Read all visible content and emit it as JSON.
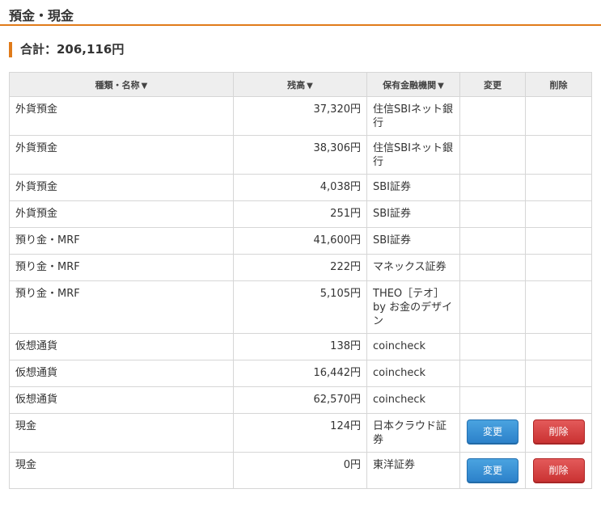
{
  "section_title": "預金・現金",
  "total_label": "合計：206,116円",
  "columns": {
    "name": "種類・名称",
    "balance": "残高",
    "institution": "保有金融機関",
    "edit": "変更",
    "delete": "削除"
  },
  "sort_icon": "triangle-down",
  "rows": [
    {
      "name": "外貨預金",
      "balance": "37,320円",
      "institution": "住信SBIネット銀行"
    },
    {
      "name": "外貨預金",
      "balance": "38,306円",
      "institution": "住信SBIネット銀行"
    },
    {
      "name": "外貨預金",
      "balance": "4,038円",
      "institution": "SBI証券"
    },
    {
      "name": "外貨預金",
      "balance": "251円",
      "institution": "SBI証券"
    },
    {
      "name": "預り金・MRF",
      "balance": "41,600円",
      "institution": "SBI証券"
    },
    {
      "name": "預り金・MRF",
      "balance": "222円",
      "institution": "マネックス証券"
    },
    {
      "name": "預り金・MRF",
      "balance": "5,105円",
      "institution": "THEO［テオ］ by お金のデザイン"
    },
    {
      "name": "仮想通貨",
      "balance": "138円",
      "institution": "coincheck"
    },
    {
      "name": "仮想通貨",
      "balance": "16,442円",
      "institution": "coincheck"
    },
    {
      "name": "仮想通貨",
      "balance": "62,570円",
      "institution": "coincheck"
    },
    {
      "name": "現金",
      "balance": "124円",
      "institution": "日本クラウド証券",
      "edit_label": "変更",
      "delete_label": "削除"
    },
    {
      "name": "現金",
      "balance": "0円",
      "institution": "東洋証券",
      "edit_label": "変更",
      "delete_label": "削除"
    }
  ],
  "colors": {
    "accent": "#e07b1a",
    "edit_button": "#2b80c9",
    "delete_button": "#c93131"
  }
}
